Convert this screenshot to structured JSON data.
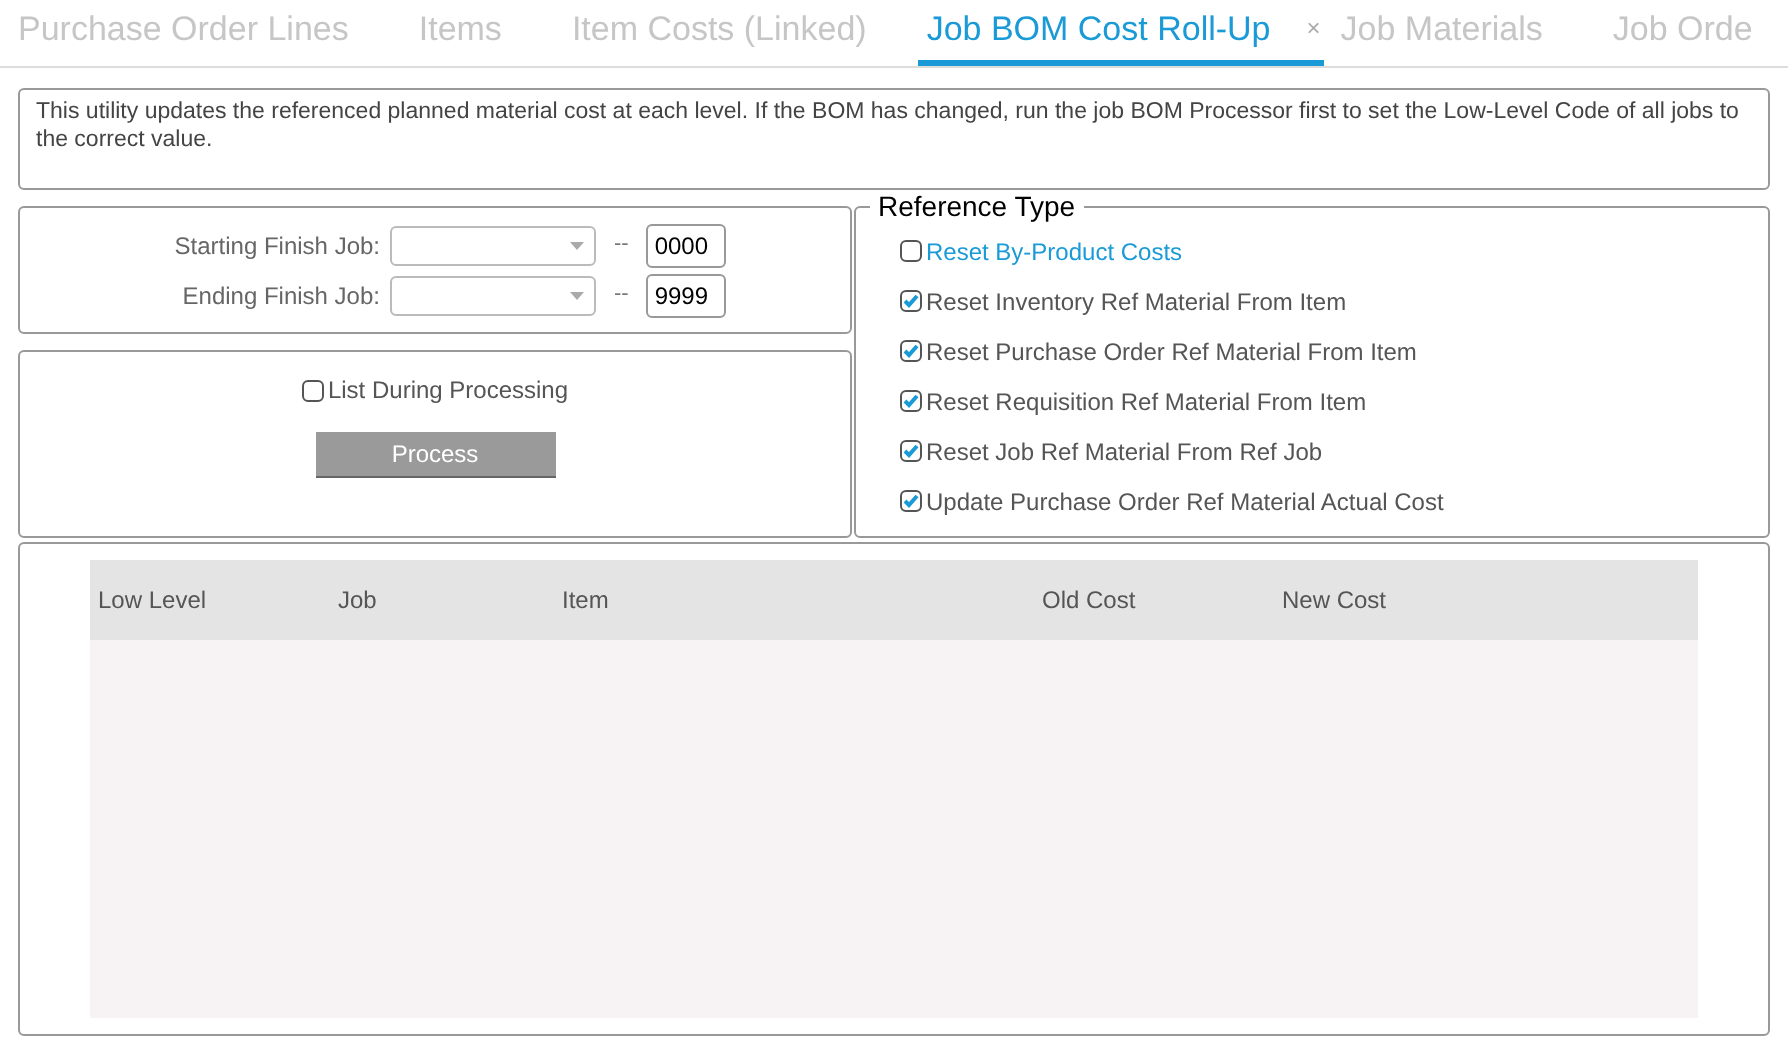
{
  "tabs": [
    {
      "label": "Purchase Order Lines",
      "selected": false
    },
    {
      "label": "Items",
      "selected": false
    },
    {
      "label": "Item Costs (Linked)",
      "selected": false
    },
    {
      "label": "Job BOM Cost Roll-Up",
      "selected": true,
      "close": "×"
    },
    {
      "label": "Job Materials",
      "selected": false
    },
    {
      "label": "Job Orde",
      "selected": false
    }
  ],
  "description": "This utility updates the referenced planned material cost at each level.  If the BOM has changed, run the job BOM Processor first to set the Low-Level Code of all jobs to the correct value.",
  "range": [
    {
      "label": "Starting Finish Job:",
      "separator": "--",
      "value": "0000"
    },
    {
      "label": "Ending Finish Job:",
      "separator": "--",
      "value": "9999"
    }
  ],
  "list_during_processing": {
    "label": "List During Processing",
    "checked": false
  },
  "process_button": "Process",
  "reference_type": {
    "legend": "Reference Type",
    "options": [
      {
        "label": "Reset By-Product Costs",
        "checked": false,
        "kind": "link"
      },
      {
        "label": "Reset Inventory Ref Material From Item",
        "checked": true,
        "kind": "plain"
      },
      {
        "label": "Reset Purchase Order Ref Material From Item",
        "checked": true,
        "kind": "plain"
      },
      {
        "label": "Reset Requisition Ref Material From Item",
        "checked": true,
        "kind": "plain"
      },
      {
        "label": "Reset Job Ref Material From Ref Job",
        "checked": true,
        "kind": "plain"
      },
      {
        "label": "Update Purchase Order Ref Material Actual Cost",
        "checked": true,
        "kind": "plain"
      }
    ]
  },
  "table": {
    "columns": [
      "Low Level",
      "Job",
      "Item",
      "Old Cost",
      "New Cost"
    ]
  }
}
